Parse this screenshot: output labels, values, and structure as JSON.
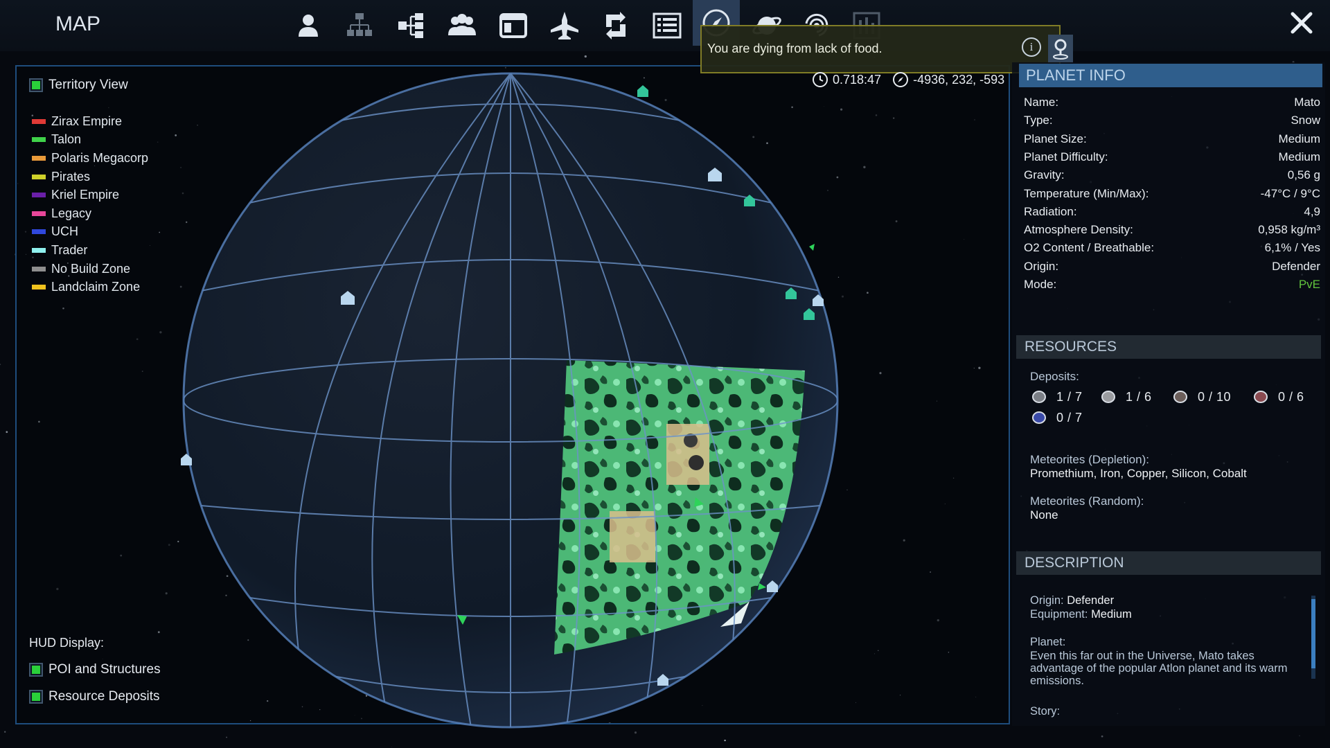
{
  "header": {
    "title": "MAP"
  },
  "nav": [
    {
      "name": "player",
      "icon": "person-icon"
    },
    {
      "name": "factions",
      "icon": "hierarchy-icon"
    },
    {
      "name": "structures",
      "icon": "structure-tree-icon"
    },
    {
      "name": "players",
      "icon": "group-icon"
    },
    {
      "name": "registry",
      "icon": "window-icon"
    },
    {
      "name": "ships",
      "icon": "ship-icon"
    },
    {
      "name": "trade",
      "icon": "exchange-icon"
    },
    {
      "name": "logbook",
      "icon": "list-icon"
    },
    {
      "name": "map",
      "icon": "compass-icon",
      "active": true
    },
    {
      "name": "solar-system",
      "icon": "planet-icon"
    },
    {
      "name": "galaxy",
      "icon": "galaxy-icon"
    },
    {
      "name": "stats",
      "icon": "chart-icon"
    }
  ],
  "close_icon": "close-icon",
  "notification": {
    "text": "You are dying from lack of food.",
    "info_icon": "info-icon",
    "pin_icon": "map-pin-icon"
  },
  "status": {
    "time": "0.718:47",
    "coordinates": "-4936, 232, -593"
  },
  "territory_view": {
    "label": "Territory View",
    "checked": true
  },
  "legend": [
    {
      "label": "Zirax Empire",
      "color": "#e03a36"
    },
    {
      "label": "Talon",
      "color": "#3fd24a"
    },
    {
      "label": "Polaris Megacorp",
      "color": "#e99a3a"
    },
    {
      "label": "Pirates",
      "color": "#cfd12a"
    },
    {
      "label": "Kriel Empire",
      "color": "#6a1fa8"
    },
    {
      "label": "Legacy",
      "color": "#e8479a"
    },
    {
      "label": "UCH",
      "color": "#2f48dd"
    },
    {
      "label": "Trader",
      "color": "#8ff0ee"
    },
    {
      "label": "No Build Zone",
      "color": "#8e8e8e"
    },
    {
      "label": "Landclaim Zone",
      "color": "#f0c21e"
    }
  ],
  "hud": {
    "label": "HUD Display:",
    "poi": {
      "label": "POI and Structures",
      "checked": true
    },
    "deposits": {
      "label": "Resource Deposits",
      "checked": true
    }
  },
  "planet_info": {
    "title": "PLANET INFO",
    "rows": [
      {
        "label": "Name:",
        "value": "Mato"
      },
      {
        "label": "Type:",
        "value": "Snow"
      },
      {
        "label": "Planet Size:",
        "value": "Medium"
      },
      {
        "label": "Planet Difficulty:",
        "value": "Medium"
      },
      {
        "label": "Gravity:",
        "value": "0,56 g"
      },
      {
        "label": "Temperature (Min/Max):",
        "value": "-47°C / 9°C"
      },
      {
        "label": "Radiation:",
        "value": "4,9"
      },
      {
        "label": "Atmosphere Density:",
        "value": "0,958 kg/m³"
      },
      {
        "label": "O2 Content / Breathable:",
        "value": "6,1% / Yes"
      },
      {
        "label": "Origin:",
        "value": "Defender"
      },
      {
        "label": "Mode:",
        "value": "PvE"
      }
    ]
  },
  "resources": {
    "title": "RESOURCES",
    "deposits_label": "Deposits:",
    "deposits": [
      {
        "value": "1 / 7",
        "icon": "ore-icon",
        "color": "#7b7f86"
      },
      {
        "value": "1 / 6",
        "icon": "ore-icon",
        "color": "#9a9ca0"
      },
      {
        "value": "0 / 10",
        "icon": "ore-icon",
        "color": "#6b5e5a"
      },
      {
        "value": "0 / 6",
        "icon": "ore-icon",
        "color": "#8a4a50"
      },
      {
        "value": "0 / 7",
        "icon": "ore-icon",
        "color": "#3a4aa8"
      }
    ],
    "meteorites_depletion_label": "Meteorites (Depletion):",
    "meteorites_depletion": "Promethium, Iron, Copper, Silicon, Cobalt",
    "meteorites_random_label": "Meteorites (Random):",
    "meteorites_random": "None"
  },
  "description": {
    "title": "DESCRIPTION",
    "origin_label": "Origin:",
    "origin_value": "Defender",
    "equipment_label": "Equipment:",
    "equipment_value": "Medium",
    "planet_label": "Planet:",
    "planet_text": "Even this far out in the Universe, Mato takes advantage of the popular Atlon planet and its warm emissions.",
    "story_label": "Story:"
  }
}
